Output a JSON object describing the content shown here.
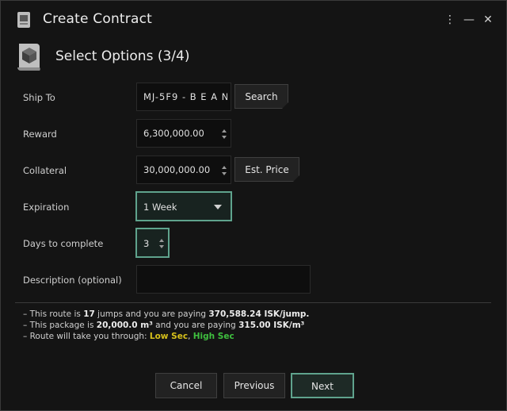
{
  "window": {
    "title": "Create Contract"
  },
  "step": {
    "title": "Select Options (3/4)"
  },
  "form": {
    "ship_to": {
      "label": "Ship To",
      "value": "MJ-5F9 - B E A N",
      "button": "Search"
    },
    "reward": {
      "label": "Reward",
      "value": "6,300,000.00"
    },
    "collateral": {
      "label": "Collateral",
      "value": "30,000,000.00",
      "button": "Est. Price"
    },
    "expiration": {
      "label": "Expiration",
      "value": "1 Week"
    },
    "days": {
      "label": "Days to complete",
      "value": "3"
    },
    "description": {
      "label": "Description (optional)",
      "value": ""
    }
  },
  "info": {
    "line1": {
      "prefix": "– This route is ",
      "jumps": "17",
      "mid": " jumps and you are paying ",
      "amount": "370,588.24",
      "suffix": " ISK/jump."
    },
    "line2": {
      "prefix": "– This package is ",
      "volume": "20,000.0 m³",
      "mid": " and you are paying ",
      "amount": "315.00",
      "suffix": " ISK/m³"
    },
    "line3": {
      "prefix": "– Route will take you through: ",
      "low": "Low Sec",
      "sep": ", ",
      "high": "High Sec"
    }
  },
  "footer": {
    "cancel": "Cancel",
    "previous": "Previous",
    "next": "Next"
  },
  "colors": {
    "accent": "#5fa38d",
    "low_sec": "#d6c01b",
    "high_sec": "#3fbf3f"
  },
  "icons": [
    "contract-icon",
    "menu-icon",
    "minimize-icon",
    "close-icon",
    "cube-icon",
    "spinner-icon",
    "caret-down-icon"
  ]
}
